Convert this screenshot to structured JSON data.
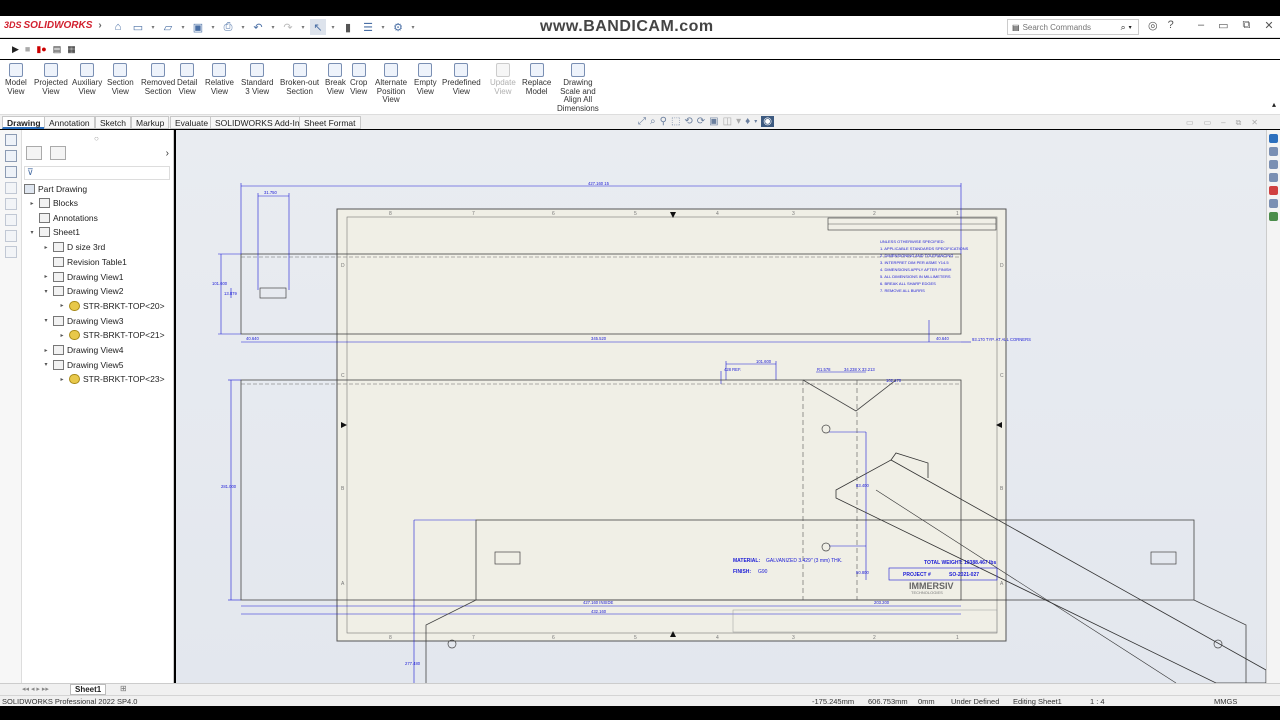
{
  "app": {
    "logo": "SOLIDWORKS",
    "logo_prefix": "3DS",
    "watermark": "www.BANDICAM.com"
  },
  "search": {
    "placeholder": "Search Commands"
  },
  "ribbon": [
    "Model\nView",
    "Projected\nView",
    "Auxiliary\nView",
    "Section\nView",
    "Removed\nSection",
    "Detail\nView",
    "Relative\nView",
    "Standard\n3 View",
    "Broken-out\nSection",
    "Break\nView",
    "Crop\nView",
    "Alternate\nPosition\nView",
    "Empty\nView",
    "Predefined\nView",
    "Update\nView",
    "Replace\nModel",
    "Drawing\nScale and\nAlign All\nDimensions"
  ],
  "tabs": [
    "Drawing",
    "Annotation",
    "Sketch",
    "Markup",
    "Evaluate",
    "SOLIDWORKS Add-Ins",
    "Sheet Format"
  ],
  "tree": {
    "root": "Part Drawing",
    "items": [
      {
        "label": "Blocks",
        "level": 1,
        "exp": "▸",
        "icon": "folder-icon"
      },
      {
        "label": "Annotations",
        "level": 1,
        "exp": "",
        "icon": "annotations-icon"
      },
      {
        "label": "Sheet1",
        "level": 1,
        "exp": "▾",
        "icon": "sheet-icon"
      },
      {
        "label": "D size 3rd",
        "level": 2,
        "exp": "▸",
        "icon": "sheet-format-icon"
      },
      {
        "label": "Revision Table1",
        "level": 2,
        "exp": "",
        "icon": "table-icon"
      },
      {
        "label": "Drawing View1",
        "level": 2,
        "exp": "▸",
        "icon": "drawing-view-icon"
      },
      {
        "label": "Drawing View2",
        "level": 2,
        "exp": "▾",
        "icon": "drawing-view-icon"
      },
      {
        "label": "STR-BRKT-TOP<20>",
        "level": 3,
        "exp": "▸",
        "icon": "part-icon"
      },
      {
        "label": "Drawing View3",
        "level": 2,
        "exp": "▾",
        "icon": "drawing-view-icon"
      },
      {
        "label": "STR-BRKT-TOP<21>",
        "level": 3,
        "exp": "▸",
        "icon": "part-icon"
      },
      {
        "label": "Drawing View4",
        "level": 2,
        "exp": "▸",
        "icon": "drawing-view-icon"
      },
      {
        "label": "Drawing View5",
        "level": 2,
        "exp": "▾",
        "icon": "drawing-view-icon"
      },
      {
        "label": "STR-BRKT-TOP<23>",
        "level": 3,
        "exp": "▸",
        "icon": "part-icon"
      }
    ]
  },
  "drawing": {
    "dims": {
      "overall_top": "427.160 15",
      "d1": "31.750",
      "d2": "101.600",
      "d3": "13.879",
      "d4": "40.640",
      "d5": "345.520",
      "d6": "40.640",
      "d7": "93.170 TYP. AT ALL CORNERS",
      "d8": "101.600",
      "d9": "428 REF.",
      "d10": "R1.578",
      "d11": "34.238 X 33.213",
      "d12": "102.170",
      "d13": "281.000",
      "d14": "83.400",
      "d15": "50.800",
      "d16": "427.160 INSIDE",
      "d17": "432.160",
      "d18": "277.480",
      "d19": "203.200"
    },
    "notes_title": "UNLESS OTHERWISE SPECIFIED:",
    "material_label": "MATERIAL:",
    "material_value": "GALVANIZED 3.429\" (3 mm) THK.",
    "finish_label": "FINISH:",
    "finish_value": "G90",
    "weight": "TOTAL WEIGHT: 10388.467 lbs",
    "project_label": "PROJECT #",
    "project_value": "SO-2021-027",
    "company": "IMMERSIV",
    "company_sub": "TECHNOLOGIES"
  },
  "sheet_tab": "Sheet1",
  "status": {
    "version": "SOLIDWORKS Professional 2022 SP4.0",
    "x": "-175.245mm",
    "y": "606.753mm",
    "z": "0mm",
    "defined": "Under Defined",
    "editing": "Editing Sheet1",
    "scale": "1 : 4",
    "units": "MMGS"
  },
  "colors": {
    "dim": "#1a1ad6",
    "accent": "#2c6fbd"
  }
}
